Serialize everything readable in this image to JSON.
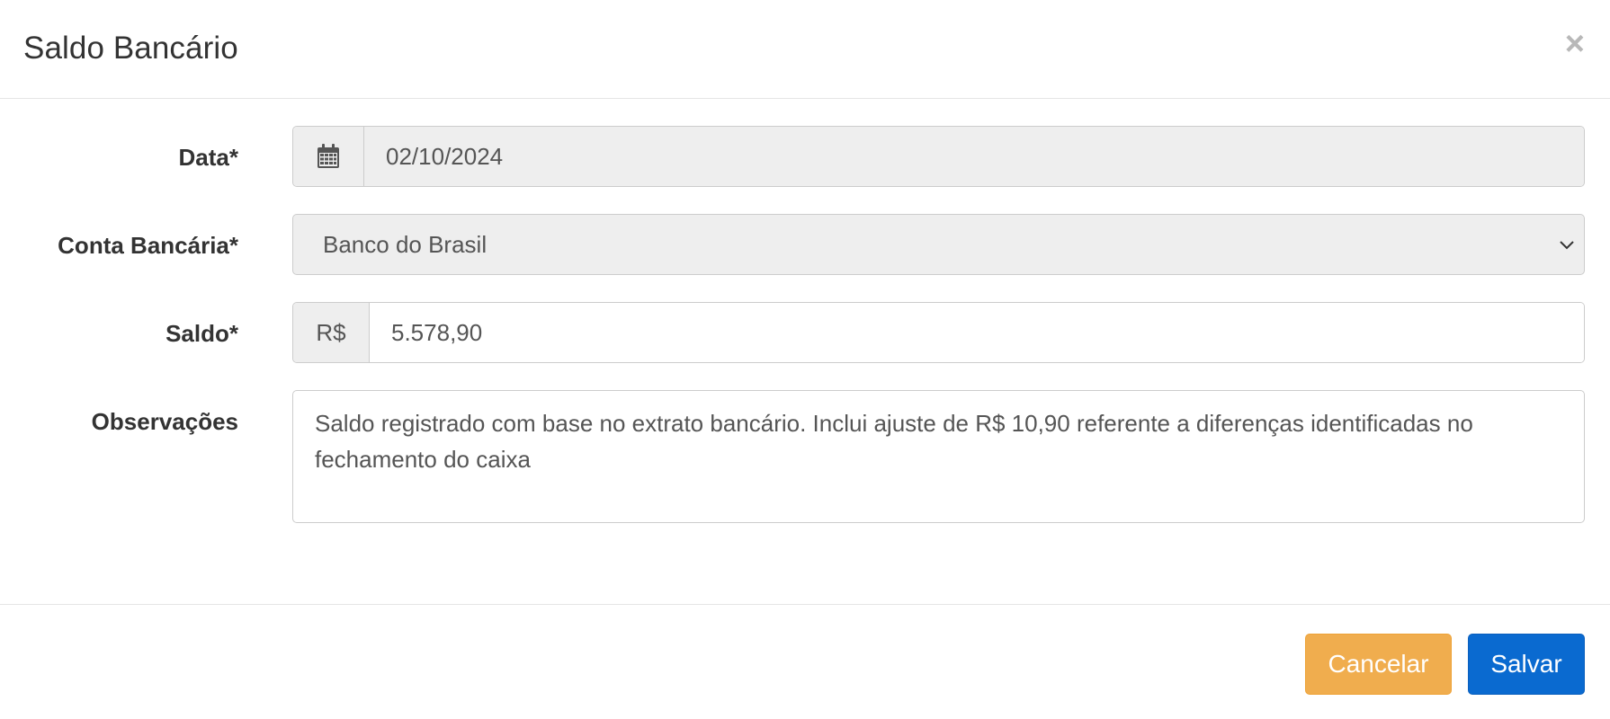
{
  "modal": {
    "title": "Saldo Bancário",
    "close_symbol": "×"
  },
  "form": {
    "data": {
      "label": "Data*",
      "icon": "calendar-icon",
      "value": "02/10/2024"
    },
    "conta": {
      "label": "Conta Bancária*",
      "selected": "Banco do Brasil",
      "icon": "chevron-down-icon"
    },
    "saldo": {
      "label": "Saldo*",
      "currency": "R$",
      "value": "5.578,90"
    },
    "observacoes": {
      "label": "Observações",
      "value": "Saldo registrado com base no extrato bancário. Inclui ajuste de R$ 10,90 referente a diferenças identificadas no fechamento do caixa"
    }
  },
  "footer": {
    "cancel_label": "Cancelar",
    "save_label": "Salvar"
  },
  "colors": {
    "cancel": "#f0ad4e",
    "save": "#0a6ad0",
    "input_disabled_bg": "#eeeeee",
    "border": "#cccccc"
  }
}
